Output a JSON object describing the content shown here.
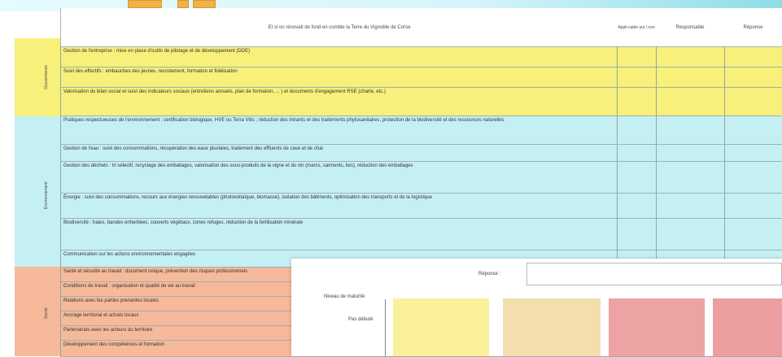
{
  "header": {
    "question": "Et si on rénovait de fond en comble la Terre du Vignoble de Corse",
    "col_applicable": "Appli-cable oui / non",
    "col_responsable": "Responsable",
    "col_reponse": "Réponse"
  },
  "sections": [
    {
      "label": "Gouvernance",
      "color": "#f7f07a",
      "rows": [
        "Gestion de l'entreprise : mise en place d'outils de pilotage et de développement (DDE)",
        "Suivi des effectifs : embauches des jeunes, recrutement, formation et fidélisation",
        "Valorisation du bilan social et suivi des indicateurs sociaux (entretiens annuels, plan de formation, ... ) et documents d'engagement RSE (charte, etc.)"
      ]
    },
    {
      "label": "Environnement",
      "color": "#c4f0f4",
      "rows": [
        "Pratiques respectueuses de l'environnement : certification biologique, HVE ou Terra Vitis ; réduction des intrants et des traitements phytosanitaires, protection de la biodiversité et des ressources naturelles",
        "Gestion de l'eau : suivi des consommations, récupération des eaux pluviales, traitement des effluents de cave et de chai",
        "Gestion des déchets : tri sélectif, recyclage des emballages, valorisation des sous-produits de la vigne et du vin (marcs, sarments, lies), réduction des emballages",
        "Énergie : suivi des consommations, recours aux énergies renouvelables (photovoltaïque, biomasse), isolation des bâtiments, optimisation des transports et de la logistique",
        "Biodiversité : haies, bandes enherbées, couverts végétaux, zones refuges, réduction de la fertilisation minérale",
        "Communication sur les actions environnementales engagées"
      ]
    },
    {
      "label": "Social",
      "color": "#f6b99a",
      "rows": [
        "Santé et sécurité au travail : document unique, prévention des risques professionnels",
        "Conditions de travail : organisation et qualité de vie au travail",
        "Relations avec les parties prenantes locales",
        "Ancrage territorial et achats locaux",
        "Partenariats avec les acteurs du territoire",
        "Développement des compétences et formation"
      ]
    }
  ],
  "popup": {
    "label_top": "Réponse :",
    "label_left1": "Niveau de maturité",
    "label_left2": "Pas débuté",
    "swatch_colors": [
      "#fbf19a",
      "#f3dfae",
      "#eda3a3",
      "#ec9ea1"
    ]
  }
}
